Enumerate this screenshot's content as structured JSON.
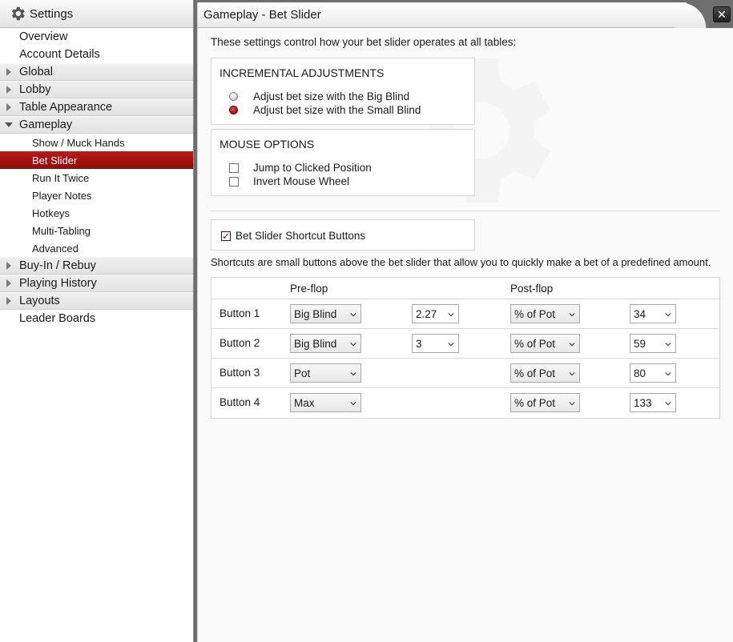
{
  "sidebar": {
    "title": "Settings",
    "items": [
      {
        "label": "Overview",
        "level": 0,
        "group": false,
        "selected": false
      },
      {
        "label": "Account Details",
        "level": 0,
        "group": false,
        "selected": false
      },
      {
        "label": "Global",
        "level": 0,
        "group": true,
        "expanded": false,
        "selected": false
      },
      {
        "label": "Lobby",
        "level": 0,
        "group": true,
        "expanded": false,
        "selected": false
      },
      {
        "label": "Table Appearance",
        "level": 0,
        "group": true,
        "expanded": false,
        "selected": false
      },
      {
        "label": "Gameplay",
        "level": 0,
        "group": true,
        "expanded": true,
        "selected": false
      },
      {
        "label": "Show / Muck Hands",
        "level": 1,
        "group": false,
        "selected": false
      },
      {
        "label": "Bet Slider",
        "level": 1,
        "group": false,
        "selected": true
      },
      {
        "label": "Run It Twice",
        "level": 1,
        "group": false,
        "selected": false
      },
      {
        "label": "Player Notes",
        "level": 1,
        "group": false,
        "selected": false
      },
      {
        "label": "Hotkeys",
        "level": 1,
        "group": false,
        "selected": false
      },
      {
        "label": "Multi-Tabling",
        "level": 1,
        "group": false,
        "selected": false
      },
      {
        "label": "Advanced",
        "level": 1,
        "group": false,
        "selected": false
      },
      {
        "label": "Buy-In / Rebuy",
        "level": 0,
        "group": true,
        "expanded": false,
        "selected": false
      },
      {
        "label": "Playing History",
        "level": 0,
        "group": true,
        "expanded": false,
        "selected": false
      },
      {
        "label": "Layouts",
        "level": 0,
        "group": true,
        "expanded": false,
        "selected": false
      },
      {
        "label": "Leader Boards",
        "level": 0,
        "group": false,
        "selected": false
      }
    ]
  },
  "main": {
    "title": "Gameplay - Bet Slider",
    "intro": "These settings control how your bet slider operates at all tables:",
    "incremental": {
      "title": "INCREMENTAL ADJUSTMENTS",
      "options": [
        {
          "label": "Adjust bet size with the Big Blind",
          "checked": false
        },
        {
          "label": "Adjust bet size with the Small Blind",
          "checked": true
        }
      ]
    },
    "mouse": {
      "title": "MOUSE OPTIONS",
      "options": [
        {
          "label": "Jump to Clicked Position",
          "checked": false
        },
        {
          "label": "Invert Mouse Wheel",
          "checked": false
        }
      ]
    },
    "shortcut_toggle": {
      "label": "Bet Slider Shortcut Buttons",
      "checked": true
    },
    "shortcut_desc": "Shortcuts are small buttons above the bet slider that allow you to quickly make a bet of a predefined amount.",
    "table": {
      "preflop_header": "Pre-flop",
      "postflop_header": "Post-flop",
      "rows": [
        {
          "label": "Button 1",
          "pre_type": "Big Blind",
          "pre_value": "2.27",
          "post_type": "% of Pot",
          "post_value": "34"
        },
        {
          "label": "Button 2",
          "pre_type": "Big Blind",
          "pre_value": "3",
          "post_type": "% of Pot",
          "post_value": "59"
        },
        {
          "label": "Button 3",
          "pre_type": "Pot",
          "pre_value": null,
          "post_type": "% of Pot",
          "post_value": "80"
        },
        {
          "label": "Button 4",
          "pre_type": "Max",
          "pre_value": null,
          "post_type": "% of Pot",
          "post_value": "133"
        }
      ]
    }
  },
  "icons": {
    "header": "gear-icon",
    "close": "close-icon"
  },
  "colors": {
    "accent": "#a50f0f",
    "radio_checked": "#8a0000"
  }
}
